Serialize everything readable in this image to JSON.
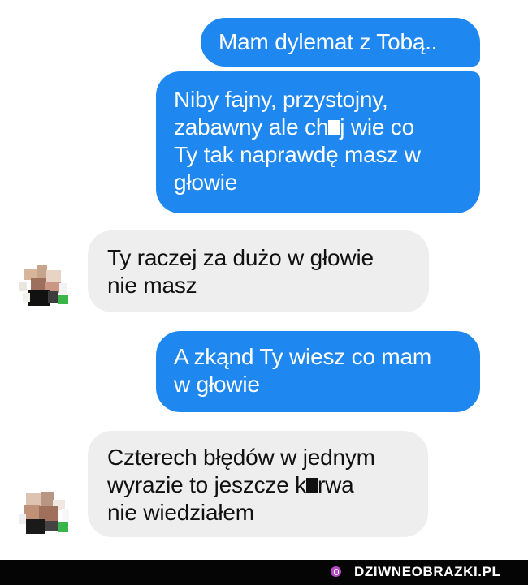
{
  "conversation": {
    "messages": [
      {
        "direction": "outgoing",
        "text": "Mam dylemat z Tobą.."
      },
      {
        "direction": "outgoing",
        "text_before_redaction": "Niby fajny, przystojny,\nzabawny ale ch",
        "text_after_redaction": "j wie co\nTy tak naprawdę masz w\ngłowie"
      },
      {
        "direction": "incoming",
        "text": "Ty raczej za dużo w głowie\nnie masz"
      },
      {
        "direction": "outgoing",
        "text": "A zkąnd Ty wiesz co mam\nw głowie"
      },
      {
        "direction": "incoming",
        "text_before_redaction": "Czterech błędów w jednym\nwyrazie to jeszcze k",
        "text_after_redaction": "rwa\nnie wiedziałem"
      }
    ]
  },
  "footer": {
    "brand": "DZIWNEOBRAZKI.PL"
  },
  "colors": {
    "outgoing_bubble": "#1e88f0",
    "incoming_bubble": "#eeeeee",
    "footer_background": "#050505",
    "brand_icon": "#b64ac7"
  }
}
